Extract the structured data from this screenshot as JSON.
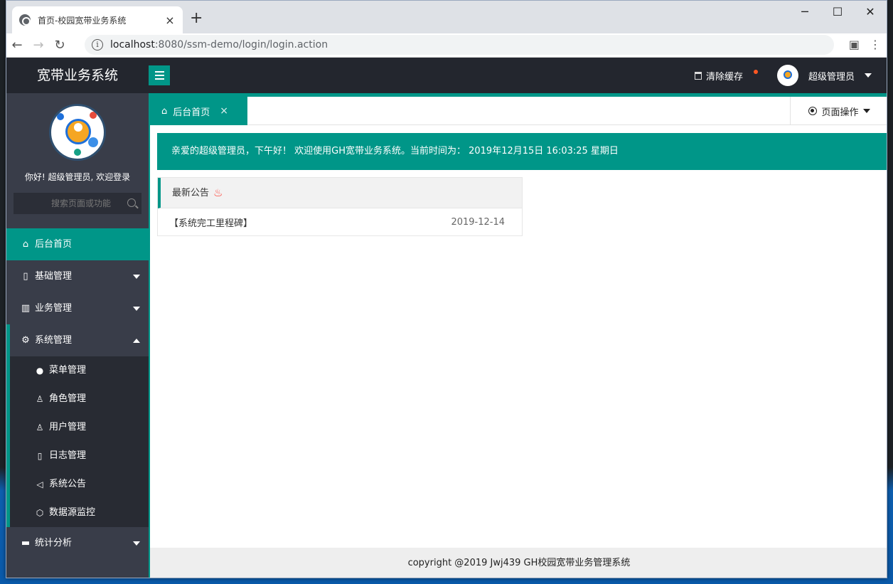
{
  "browser": {
    "tab_title": "首页-校园宽带业务系统",
    "tab_close": "×",
    "new_tab": "+",
    "win_min": "─",
    "win_max": "☐",
    "win_close": "✕",
    "url_host": "localhost",
    "url_path": ":8080/ssm-demo/login/login.action"
  },
  "header": {
    "app_title": "宽带业务系统",
    "clear_cache": "清除缓存",
    "user_name": "超级管理员"
  },
  "sidebar": {
    "welcome": "你好! 超级管理员, 欢迎登录",
    "search_placeholder": "搜索页面或功能",
    "items": [
      {
        "label": "后台首页"
      },
      {
        "label": "基础管理"
      },
      {
        "label": "业务管理"
      },
      {
        "label": "系统管理"
      },
      {
        "label": "统计分析"
      }
    ],
    "sub_items": [
      {
        "label": "菜单管理"
      },
      {
        "label": "角色管理"
      },
      {
        "label": "用户管理"
      },
      {
        "label": "日志管理"
      },
      {
        "label": "系统公告"
      },
      {
        "label": "数据源监控"
      }
    ]
  },
  "main": {
    "active_tab": "后台首页",
    "tab_close": "×",
    "page_ops": "页面操作",
    "banner": "亲爱的超级管理员，下午好！ 欢迎使用GH宽带业务系统。当前时间为： 2019年12月15日 16:03:25   星期日",
    "notice_title": "最新公告",
    "notices": [
      {
        "title": "【系统完工里程碑】",
        "date": "2019-12-14"
      }
    ],
    "footer": "copyright @2019 Jwj439 GH校园宽带业务管理系统"
  },
  "colors": {
    "accent": "#009688",
    "header_bg": "#23262e",
    "sidebar_bg": "#393d49",
    "badge_dot": "#ff5722"
  }
}
